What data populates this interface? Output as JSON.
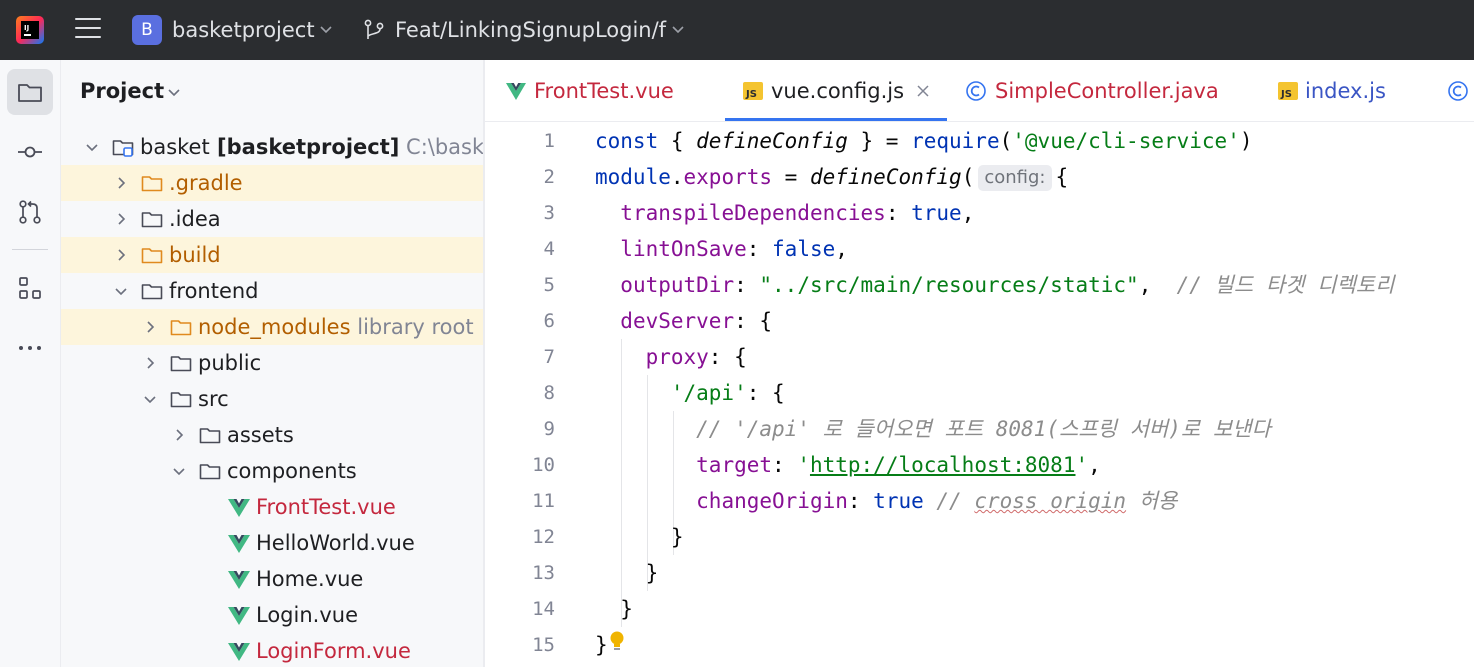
{
  "titlebar": {
    "project_badge": "B",
    "project_name": "basketproject",
    "branch": "Feat/LinkingSignupLogin/f"
  },
  "toolstrip": {
    "tools": [
      "folder-icon",
      "commit-icon",
      "pull-request-icon",
      "structure-icon",
      "more-icon"
    ]
  },
  "project_panel": {
    "title": "Project",
    "tree": [
      {
        "label": "basket",
        "bold": "[basketproject]",
        "sub": "C:\\basket",
        "type": "module",
        "depth": 1,
        "expanded": true
      },
      {
        "label": ".gradle",
        "type": "folder",
        "depth": 2,
        "expanded": false,
        "color": "orange",
        "highlight": true
      },
      {
        "label": ".idea",
        "type": "folder",
        "depth": 2,
        "expanded": false
      },
      {
        "label": "build",
        "type": "folder",
        "depth": 2,
        "expanded": false,
        "color": "orange",
        "highlight": true
      },
      {
        "label": "frontend",
        "type": "folder",
        "depth": 2,
        "expanded": true
      },
      {
        "label": "node_modules",
        "sub": "library root",
        "type": "folder",
        "depth": 3,
        "expanded": false,
        "color": "orange",
        "highlight": true
      },
      {
        "label": "public",
        "type": "folder",
        "depth": 3,
        "expanded": false
      },
      {
        "label": "src",
        "type": "folder",
        "depth": 3,
        "expanded": true
      },
      {
        "label": "assets",
        "type": "folder",
        "depth": 4,
        "expanded": false
      },
      {
        "label": "components",
        "type": "folder",
        "depth": 4,
        "expanded": true
      },
      {
        "label": "FrontTest.vue",
        "type": "vue",
        "depth": 5,
        "color": "red"
      },
      {
        "label": "HelloWorld.vue",
        "type": "vue",
        "depth": 5
      },
      {
        "label": "Home.vue",
        "type": "vue",
        "depth": 5
      },
      {
        "label": "Login.vue",
        "type": "vue",
        "depth": 5
      },
      {
        "label": "LoginForm.vue",
        "type": "vue",
        "depth": 5,
        "color": "red"
      }
    ]
  },
  "tabs": [
    {
      "label": "FrontTest.vue",
      "type": "vue",
      "color": "#c4283e",
      "active": false
    },
    {
      "label": "vue.config.js",
      "type": "js",
      "color": "#1e1f22",
      "active": true
    },
    {
      "label": "SimpleController.java",
      "type": "class",
      "color": "#c4283e",
      "active": false
    },
    {
      "label": "index.js",
      "type": "js",
      "color": "#3a55c4",
      "active": false
    }
  ],
  "editor": {
    "line_numbers": [
      "1",
      "2",
      "3",
      "4",
      "5",
      "6",
      "7",
      "8",
      "9",
      "10",
      "11",
      "12",
      "13",
      "14",
      "15"
    ],
    "inlay_hint": "config:",
    "tokens": {
      "l1_const": "const",
      "l1_open": " { ",
      "l1_define": "defineConfig",
      "l1_close": " } = ",
      "l1_require": "require",
      "l1_paren": "(",
      "l1_str": "'@vue/cli-service'",
      "l1_end": ")",
      "l2_module": "module",
      "l2_dot": ".",
      "l2_exports": "exports",
      "l2_eq": " = ",
      "l2_define": "defineConfig",
      "l2_paren": "(",
      "l2_brace": "{",
      "l3_prop": "transpileDependencies",
      "l3_colon": ": ",
      "l3_val": "true",
      "l3_comma": ",",
      "l4_prop": "lintOnSave",
      "l4_colon": ": ",
      "l4_val": "false",
      "l4_comma": ",",
      "l5_prop": "outputDir",
      "l5_colon": ": ",
      "l5_str": "\"../src/main/resources/static\"",
      "l5_comma": ",  ",
      "l5_comment": "// 빌드 타겟 디렉토리",
      "l6_prop": "devServer",
      "l6_rest": ": {",
      "l7_prop": "proxy",
      "l7_rest": ": {",
      "l8_str": "'/api'",
      "l8_rest": ": {",
      "l9_comment": "// '/api' 로 들어오면 포트 8081(스프링 서버)로 보낸다",
      "l10_prop": "target",
      "l10_colon": ": ",
      "l10_q1": "'",
      "l10_url": "http://localhost:8081",
      "l10_q2": "'",
      "l10_comma": ",",
      "l11_prop": "changeOrigin",
      "l11_colon": ": ",
      "l11_val": "true",
      "l11_sp": " ",
      "l11_c1": "// ",
      "l11_c2": "cross origin",
      "l11_c3": " 허용",
      "l12": "}",
      "l13": "}",
      "l14": "}",
      "l15": "}"
    }
  }
}
